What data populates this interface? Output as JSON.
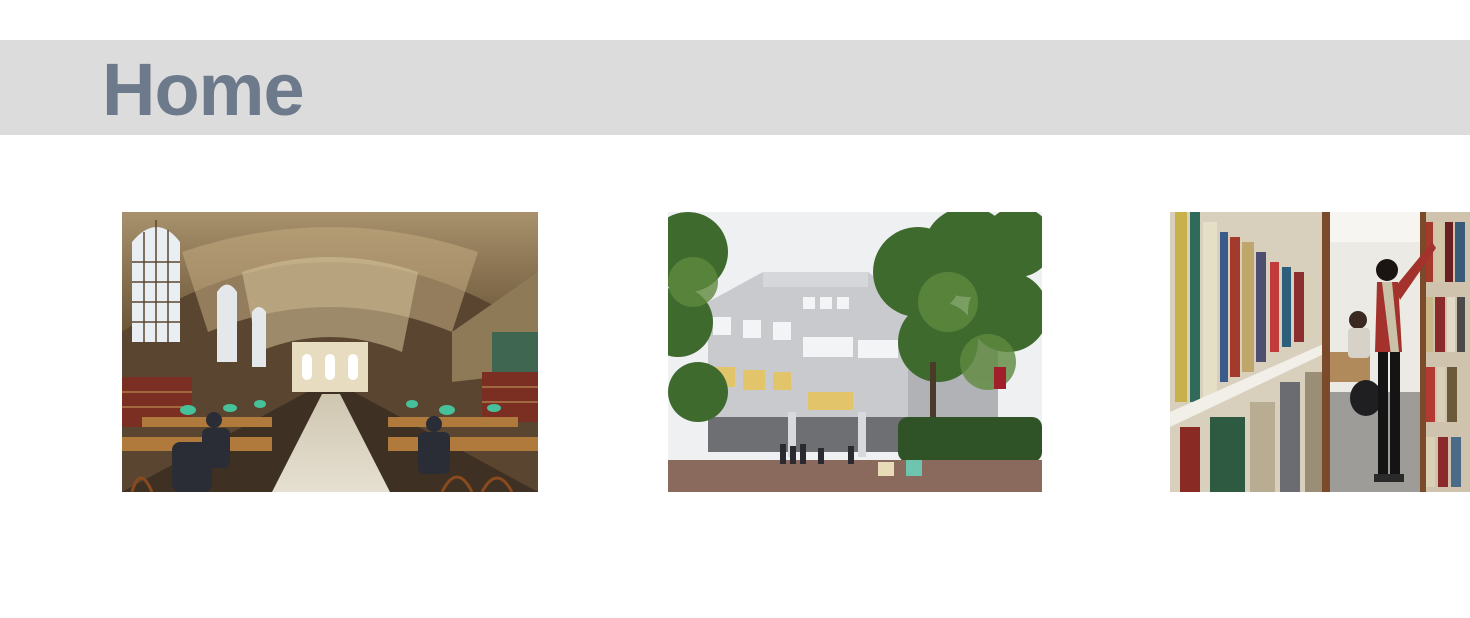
{
  "header": {
    "title": "Home"
  },
  "gallery": {
    "images": [
      {
        "subject": "library-reading-room-photo"
      },
      {
        "subject": "library-building-exterior-photo"
      },
      {
        "subject": "library-bookshelves-photo"
      }
    ]
  },
  "colors": {
    "header_background": "#dcdcdc",
    "title_text": "#6d7a8c",
    "page_background": "#ffffff"
  }
}
